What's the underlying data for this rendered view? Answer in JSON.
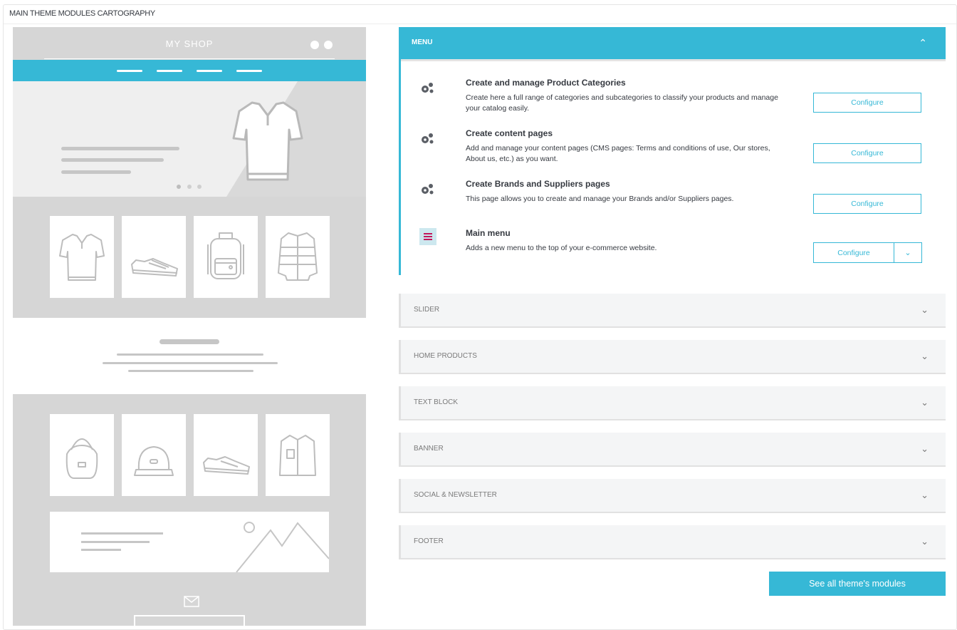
{
  "panel": {
    "heading": "MAIN THEME MODULES CARTOGRAPHY"
  },
  "mockup": {
    "shop_title": "MY SHOP"
  },
  "accordion": {
    "menu": {
      "label": "MENU",
      "expanded": true,
      "items": [
        {
          "title": "Create and manage Product Categories",
          "description": "Create here a full range of categories and subcategories to classify your products and manage your catalog easily.",
          "icon": "gears-icon",
          "button": "Configure"
        },
        {
          "title": "Create content pages",
          "description": "Add and manage your content pages (CMS pages: Terms and conditions of use, Our stores, About us, etc.) as you want.",
          "icon": "gears-icon",
          "button": "Configure"
        },
        {
          "title": "Create Brands and Suppliers pages",
          "description": "This page allows you to create and manage your Brands and/or Suppliers pages.",
          "icon": "gears-icon",
          "button": "Configure"
        },
        {
          "title": "Main menu",
          "description": "Adds a new menu to the top of your e-commerce website.",
          "icon": "main-menu-icon",
          "button": "Configure"
        }
      ]
    },
    "sections": [
      {
        "label": "SLIDER"
      },
      {
        "label": "HOME PRODUCTS"
      },
      {
        "label": "TEXT BLOCK"
      },
      {
        "label": "BANNER"
      },
      {
        "label": "SOCIAL & NEWSLETTER"
      },
      {
        "label": "FOOTER"
      }
    ]
  },
  "see_all_button": "See all theme's modules",
  "colors": {
    "accent": "#36b8d6",
    "mock_grey": "#d6d6d6",
    "text": "#363a41"
  }
}
